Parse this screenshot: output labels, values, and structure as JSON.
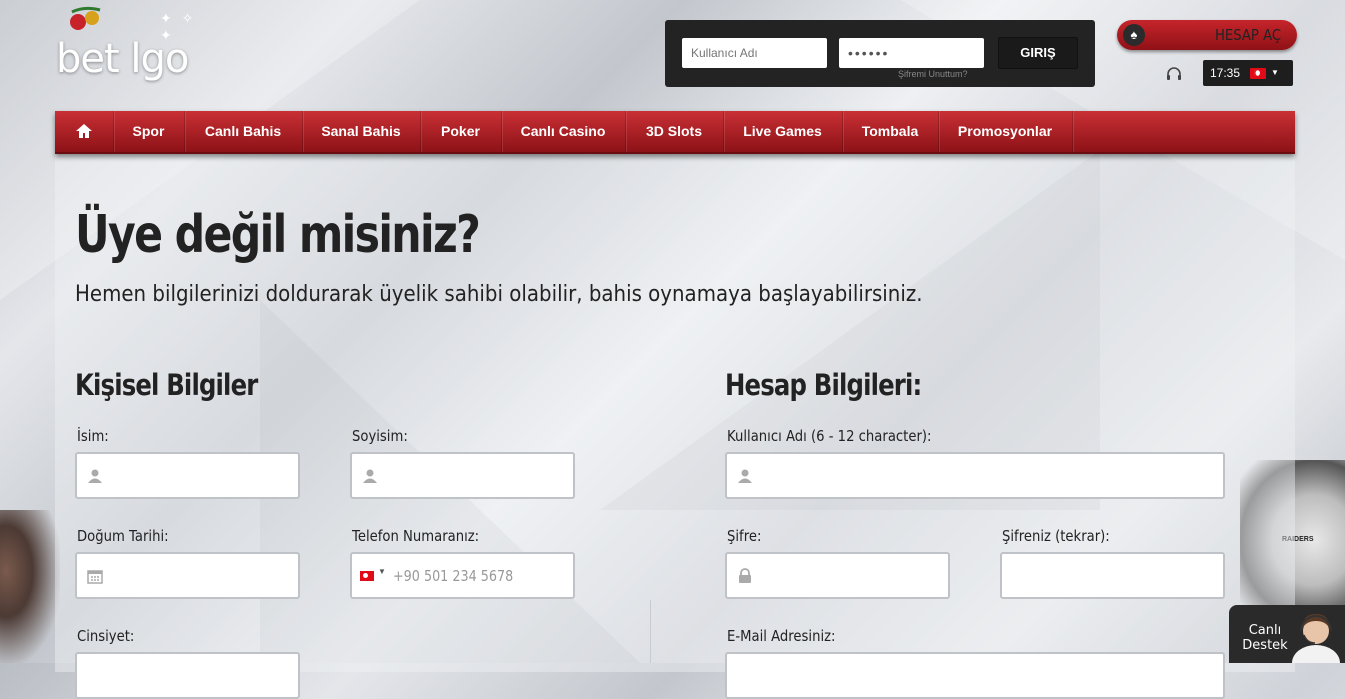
{
  "logo": {
    "text": "bet lgo"
  },
  "login": {
    "username_placeholder": "Kullanıcı Adı",
    "password_value": "••••••",
    "submit_label": "GIRIŞ",
    "forgot_label": "Şifremi Unuttum?"
  },
  "header": {
    "register_label": "HESAP AÇ",
    "time": "17:35",
    "language_flag": "turkey-flag-icon"
  },
  "nav": {
    "items": [
      {
        "label": "",
        "icon": "home-icon"
      },
      {
        "label": "Spor"
      },
      {
        "label": "Canlı Bahis"
      },
      {
        "label": "Sanal Bahis"
      },
      {
        "label": "Poker"
      },
      {
        "label": "Canlı Casino"
      },
      {
        "label": "3D Slots"
      },
      {
        "label": "Live Games"
      },
      {
        "label": "Tombala"
      },
      {
        "label": "Promosyonlar"
      }
    ]
  },
  "main": {
    "title": "Üye değil misiniz?",
    "subtitle": "Hemen bilgilerinizi doldurarak üyelik sahibi olabilir, bahis oynamaya başlayabilirsiniz."
  },
  "personal": {
    "heading": "Kişisel Bilgiler",
    "first_name_label": "İsim:",
    "last_name_label": "Soyisim:",
    "birth_label": "Doğum Tarihi:",
    "phone_label": "Telefon Numaranız:",
    "phone_placeholder": "+90 501 234 5678",
    "gender_label": "Cinsiyet:"
  },
  "account": {
    "heading": "Hesap Bilgileri:",
    "username_label": "Kullanıcı Adı (6 - 12 character):",
    "password_label": "Şifre:",
    "password_repeat_label": "Şifreniz (tekrar):",
    "email_label": "E-Mail Adresiniz:"
  },
  "live_support": {
    "line1": "Canlı",
    "line2": "Destek"
  },
  "colors": {
    "brand_red": "#b21f25",
    "dark": "#232323"
  }
}
